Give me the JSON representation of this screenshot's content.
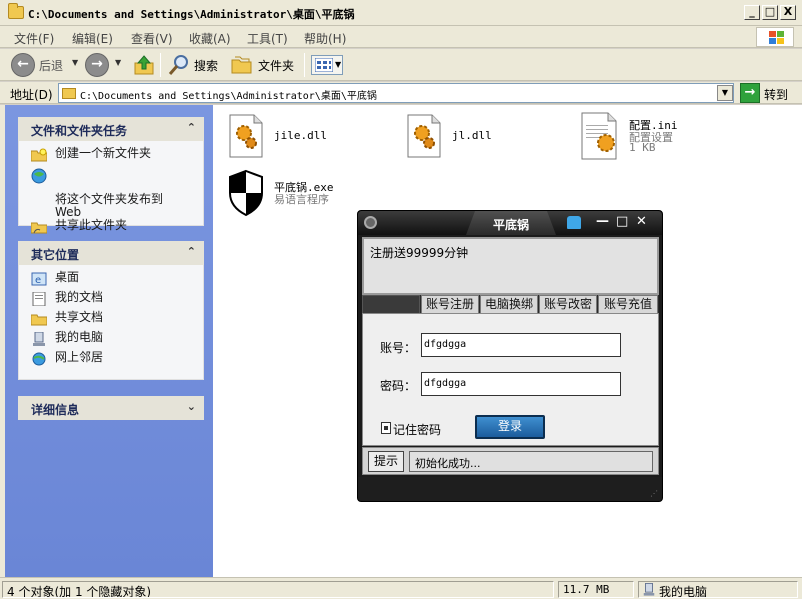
{
  "window": {
    "title": "C:\\Documents and Settings\\Administrator\\桌面\\平底锅",
    "minimize": "_",
    "maximize": "□",
    "close": "X"
  },
  "menu": {
    "items": [
      "文件(F)",
      "编辑(E)",
      "查看(V)",
      "收藏(A)",
      "工具(T)",
      "帮助(H)"
    ]
  },
  "toolbar": {
    "back_label": "后退",
    "forward_glyph": "→",
    "back_glyph": "←",
    "caret": "▼",
    "search_label": "搜索",
    "folders_label": "文件夹"
  },
  "address": {
    "label": "地址(D)",
    "value": "C:\\Documents and Settings\\Administrator\\桌面\\平底锅",
    "go_label": "转到",
    "go_glyph": "→",
    "dropdown_glyph": "▼"
  },
  "tasks_panel": {
    "title": "文件和文件夹任务",
    "collapse": "«",
    "links": [
      {
        "label": "创建一个新文件夹",
        "icon": "new-folder-icon"
      },
      {
        "label": "将这个文件夹发布到\nWeb",
        "icon": "publish-web-icon"
      },
      {
        "label": "共享此文件夹",
        "icon": "share-folder-icon"
      }
    ]
  },
  "places_panel": {
    "title": "其它位置",
    "collapse": "«",
    "links": [
      {
        "label": "桌面",
        "icon": "desktop-icon"
      },
      {
        "label": "我的文档",
        "icon": "my-documents-icon"
      },
      {
        "label": "共享文档",
        "icon": "shared-documents-icon"
      },
      {
        "label": "我的电脑",
        "icon": "my-computer-icon"
      },
      {
        "label": "网上邻居",
        "icon": "network-places-icon"
      }
    ]
  },
  "details_panel": {
    "title": "详细信息",
    "expand": "»"
  },
  "files": [
    {
      "name": "jile.dll",
      "desc": "",
      "icon": "dll-file-icon"
    },
    {
      "name": "jl.dll",
      "desc": "",
      "icon": "dll-file-icon"
    },
    {
      "name": "配置.ini",
      "desc": "配置设置",
      "size": "1 KB",
      "icon": "ini-file-icon"
    },
    {
      "name": "平底锅.exe",
      "desc": "易语言程序",
      "icon": "exe-shield-icon"
    }
  ],
  "dialog": {
    "title": "平底锅",
    "minimize": "—",
    "maximize": "□",
    "close": "✕",
    "notice": "注册送99999分钟",
    "tabs": [
      "账号注册",
      "电脑换绑",
      "账号改密",
      "账号充值"
    ],
    "account_label": "账号：",
    "account_value": "dfgdgga",
    "password_label": "密码：",
    "password_value": "dfgdgga",
    "remember_label": "记住密码",
    "remember_checked": true,
    "login_label": "登录",
    "hint_label": "提示",
    "status_text": "初始化成功..."
  },
  "statusbar": {
    "objects": "4 个对象(加 1 个隐藏对象)",
    "size": "11.7 MB",
    "location": "我的电脑"
  },
  "colors": {
    "left_pane": "#6e8bdc",
    "dialog_bg": "#1b1b1b",
    "login_button": "#2c78bc",
    "go_button": "#2fa23c"
  }
}
